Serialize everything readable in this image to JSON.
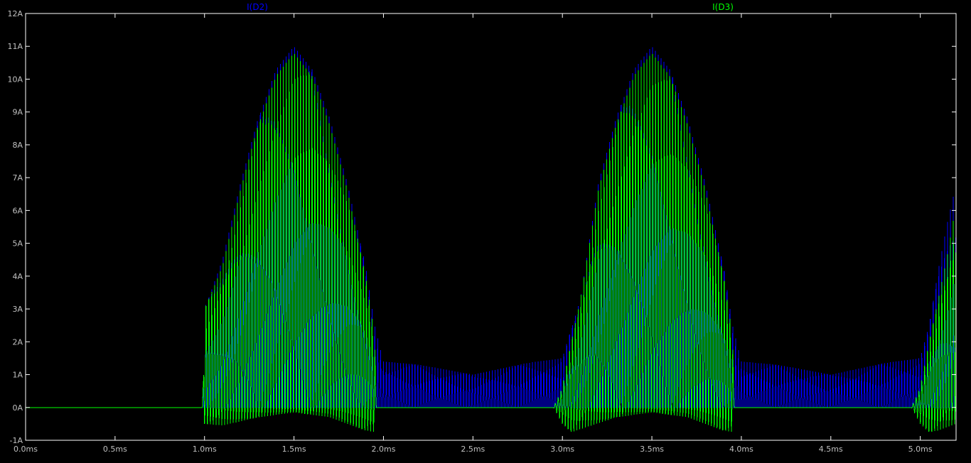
{
  "chart_data": {
    "type": "line",
    "title": "",
    "xlabel": "",
    "ylabel": "",
    "xlim": [
      0,
      5.2
    ],
    "ylim": [
      -1,
      12
    ],
    "x_unit": "ms",
    "y_unit": "A",
    "x_ticks": [
      0.0,
      0.5,
      1.0,
      1.5,
      2.0,
      2.5,
      3.0,
      3.5,
      4.0,
      4.5,
      5.0
    ],
    "x_tick_labels": [
      "0.0ms",
      "0.5ms",
      "1.0ms",
      "1.5ms",
      "2.0ms",
      "2.5ms",
      "3.0ms",
      "3.5ms",
      "4.0ms",
      "4.5ms",
      "5.0ms"
    ],
    "y_ticks": [
      -1,
      0,
      1,
      2,
      3,
      4,
      5,
      6,
      7,
      8,
      9,
      10,
      11,
      12
    ],
    "y_tick_labels": [
      "-1A",
      "0A",
      "1A",
      "2A",
      "3A",
      "4A",
      "5A",
      "6A",
      "7A",
      "8A",
      "9A",
      "10A",
      "11A",
      "12A"
    ],
    "grid": false,
    "legend_placement": "top",
    "background": "#000000",
    "axis_color": "#ffffff",
    "series": [
      {
        "name": "I(D2)",
        "color": "#0000ff",
        "style": "pulse-train",
        "envelope_x": [
          0.0,
          0.99,
          1.0,
          1.1,
          1.2,
          1.3,
          1.4,
          1.5,
          1.6,
          1.7,
          1.8,
          1.9,
          1.95,
          2.0,
          2.2,
          2.5,
          2.8,
          3.0,
          3.1,
          3.2,
          3.3,
          3.4,
          3.5,
          3.6,
          3.7,
          3.8,
          3.9,
          3.95,
          4.0,
          4.2,
          4.5,
          4.8,
          5.0,
          5.05,
          5.1,
          5.15,
          5.2
        ],
        "envelope_y": [
          0.0,
          0.0,
          3.0,
          4.5,
          6.8,
          8.8,
          10.3,
          11.0,
          10.3,
          8.8,
          6.8,
          4.3,
          2.5,
          1.4,
          1.3,
          1.0,
          1.35,
          1.5,
          3.3,
          6.8,
          8.8,
          10.3,
          11.0,
          10.3,
          8.8,
          6.8,
          4.3,
          2.5,
          1.4,
          1.3,
          1.0,
          1.35,
          1.5,
          2.5,
          4.2,
          5.6,
          6.8
        ]
      },
      {
        "name": "I(D3)",
        "color": "#00ff00",
        "style": "pulse-train",
        "envelope_x": [
          0.0,
          0.99,
          1.0,
          1.1,
          1.2,
          1.3,
          1.4,
          1.5,
          1.6,
          1.7,
          1.8,
          1.9,
          1.95,
          1.96,
          2.95,
          3.0,
          3.05,
          3.1,
          3.2,
          3.3,
          3.4,
          3.5,
          3.6,
          3.7,
          3.8,
          3.9,
          3.95,
          3.96,
          4.95,
          5.0,
          5.05,
          5.1,
          5.15,
          5.2
        ],
        "envelope_y": [
          0.0,
          0.0,
          3.0,
          4.3,
          6.6,
          8.6,
          10.1,
          10.8,
          10.1,
          8.6,
          6.6,
          4.0,
          2.2,
          0.0,
          0.0,
          0.6,
          2.0,
          3.3,
          6.6,
          8.6,
          10.1,
          10.8,
          10.1,
          8.6,
          6.6,
          4.0,
          2.2,
          0.0,
          0.0,
          0.6,
          2.0,
          3.3,
          4.6,
          6.2
        ],
        "negative_envelope_x": [
          0.99,
          1.0,
          1.1,
          1.3,
          1.5,
          1.7,
          1.9,
          1.95,
          1.96,
          2.95,
          3.0,
          3.05,
          3.3,
          3.5,
          3.7,
          3.9,
          3.95,
          3.96,
          4.95,
          5.0,
          5.05,
          5.1,
          5.2
        ],
        "negative_envelope_y": [
          0.0,
          -0.5,
          -0.55,
          -0.3,
          -0.15,
          -0.3,
          -0.7,
          -0.75,
          0.0,
          0.0,
          -0.5,
          -0.75,
          -0.3,
          -0.15,
          -0.3,
          -0.7,
          -0.75,
          0.0,
          0.0,
          -0.5,
          -0.75,
          -0.7,
          -0.5
        ]
      }
    ]
  }
}
